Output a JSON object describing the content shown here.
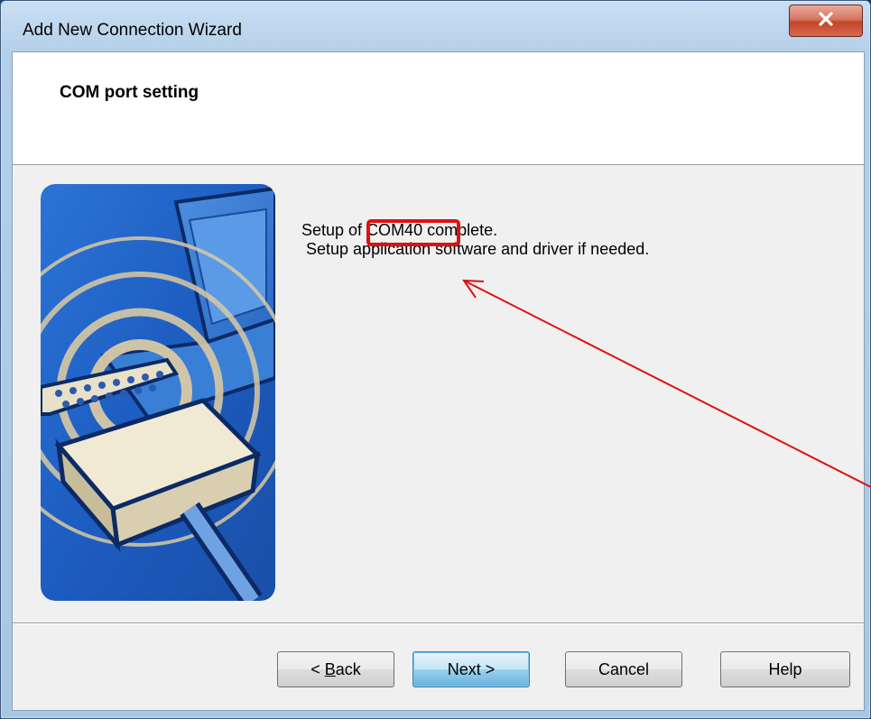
{
  "window": {
    "title": "Add New Connection Wizard",
    "close_glyph": "X"
  },
  "header": {
    "title": "COM port setting"
  },
  "message": {
    "line1_prefix": "Setup of ",
    "port_name": "COM40",
    "line1_suffix": " complete.",
    "line2": " Setup application software and driver if needed."
  },
  "buttons": {
    "back_prefix": "< ",
    "back_accel": "B",
    "back_rest": "ack",
    "next": "Next >",
    "cancel": "Cancel",
    "help": "Help"
  },
  "annotation": {
    "highlight_color": "#e01010"
  },
  "colors": {
    "default_button": "#98d1ef",
    "illustration_blue": "#1f5fc4"
  }
}
